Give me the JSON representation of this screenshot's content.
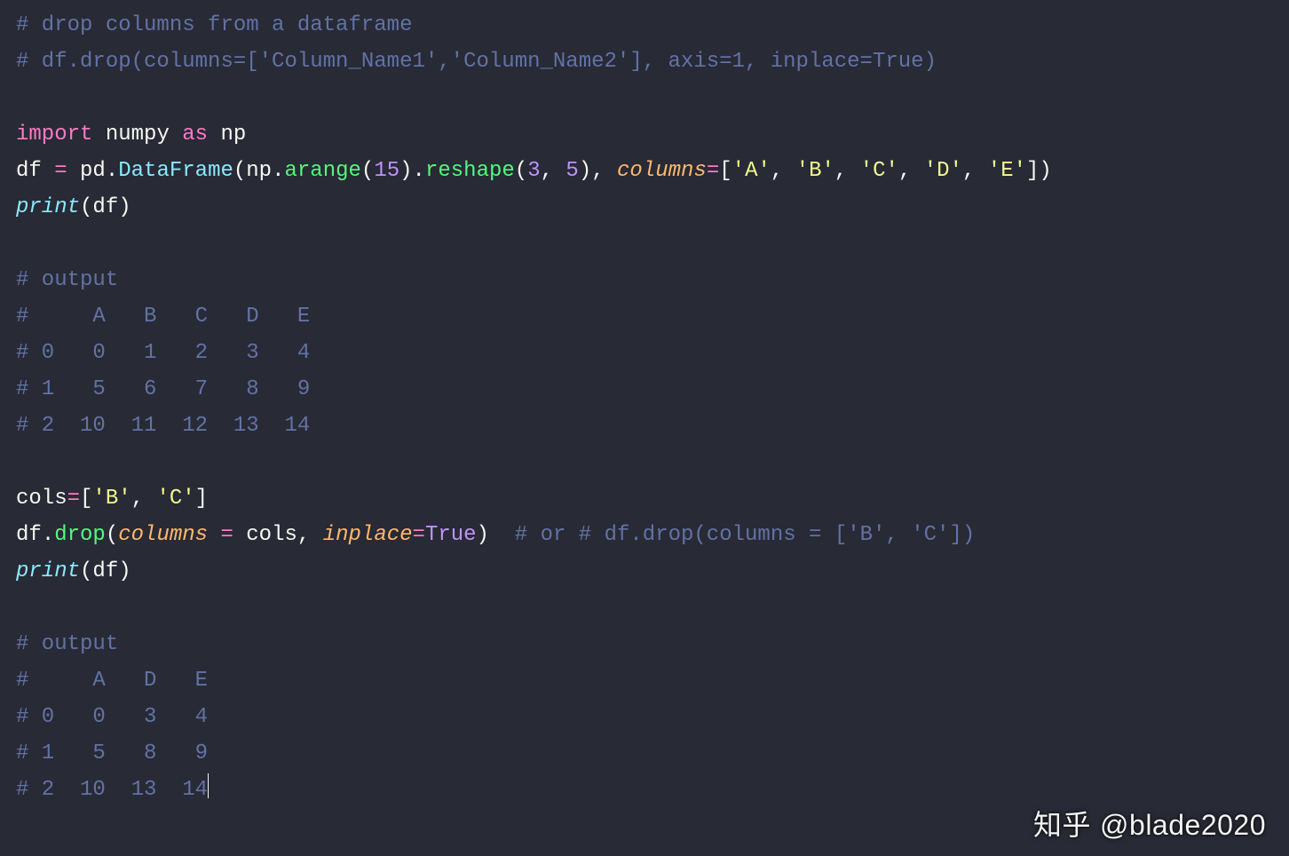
{
  "code": {
    "l1_comment": "# drop columns from a dataframe",
    "l2_comment": "# df.drop(columns=['Column_Name1','Column_Name2'], axis=1, inplace=True)",
    "kw_import": "import",
    "mod_numpy": "numpy",
    "kw_as": "as",
    "alias_np": "np",
    "var_df": "df",
    "op_eq": "=",
    "mod_pd": "pd",
    "cls_DataFrame": "DataFrame",
    "fn_arange": "arange",
    "num_15": "15",
    "fn_reshape": "reshape",
    "num_3": "3",
    "num_5": "5",
    "param_columns": "columns",
    "list_open": "[",
    "list_close": "]",
    "str_A": "'A'",
    "str_B": "'B'",
    "str_C": "'C'",
    "str_D": "'D'",
    "str_E": "'E'",
    "fn_print": "print",
    "out_label": "# output",
    "out1_l1": "#     A   B   C   D   E",
    "out1_l2": "# 0   0   1   2   3   4",
    "out1_l3": "# 1   5   6   7   8   9",
    "out1_l4": "# 2  10  11  12  13  14",
    "var_cols": "cols",
    "fn_drop": "drop",
    "param_inplace": "inplace",
    "bool_true": "True",
    "trail_comment": "# or # df.drop(columns = ['B', 'C'])",
    "out2_l1": "#     A   D   E",
    "out2_l2": "# 0   0   3   4",
    "out2_l3": "# 1   5   8   9",
    "out2_l4": "# 2  10  13  14"
  },
  "watermark": {
    "site": "知乎",
    "user": "@blade2020"
  }
}
